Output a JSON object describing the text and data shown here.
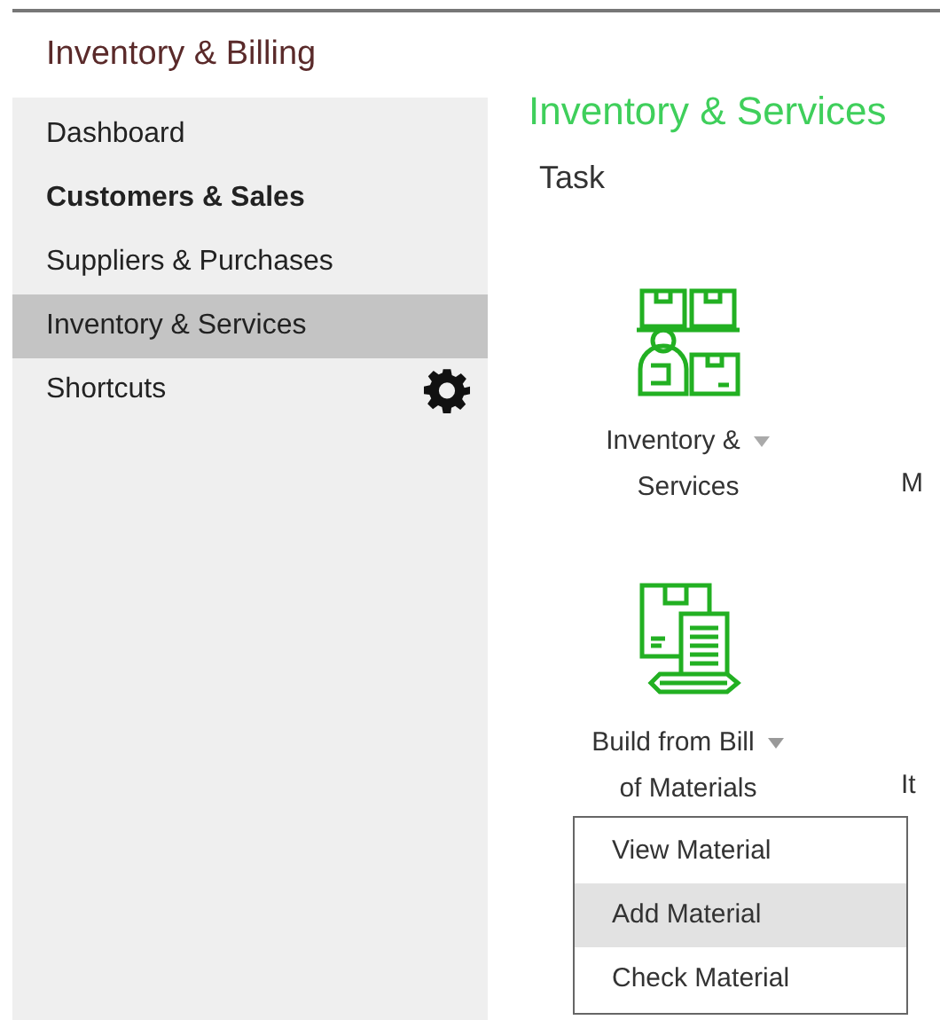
{
  "app_title": "Inventory & Billing",
  "sidebar": {
    "items": [
      {
        "label": "Dashboard",
        "selected": false,
        "bold": false
      },
      {
        "label": "Customers & Sales",
        "selected": false,
        "bold": true
      },
      {
        "label": "Suppliers & Purchases",
        "selected": false,
        "bold": false
      },
      {
        "label": "Inventory & Services",
        "selected": true,
        "bold": false
      },
      {
        "label": "Shortcuts",
        "selected": false,
        "bold": false,
        "kind": "settings"
      }
    ]
  },
  "main": {
    "heading": "Inventory & Services",
    "section": "Task",
    "rows": [
      {
        "tile": {
          "kind": "warehouse",
          "label_lines": [
            "Inventory &",
            "Services"
          ]
        },
        "column_2": "M"
      },
      {
        "tile": {
          "kind": "bill",
          "label_lines": [
            "Build from Bill",
            "of Materials"
          ],
          "expanded": true,
          "menu": [
            {
              "label": "View Material",
              "selected": false
            },
            {
              "label": "Add Material",
              "selected": true
            },
            {
              "label": "Check Material",
              "selected": false
            }
          ]
        },
        "column_2": "It"
      }
    ]
  }
}
